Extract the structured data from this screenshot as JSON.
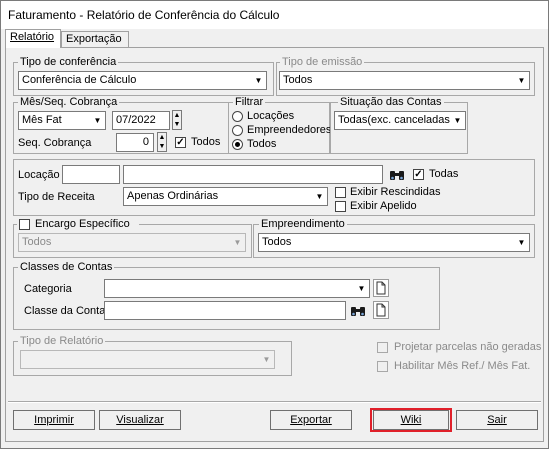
{
  "window": {
    "title": "Faturamento - Relatório de Conferência do Cálculo"
  },
  "tabs": {
    "relatorio": "Relatório",
    "exportacao": "Exportação"
  },
  "tipo_conferencia": {
    "label": "Tipo de conferência",
    "value": "Conferência de Cálculo"
  },
  "tipo_emissao": {
    "label": "Tipo de emissão",
    "value": "Todos"
  },
  "mes_seq": {
    "label": "Mês/Seq. Cobrança",
    "mes_select": "Mês Fat",
    "mes_value": "07/2022",
    "seq_label": "Seq. Cobrança",
    "seq_value": "0",
    "todos_label": "Todos",
    "todos_checked": true
  },
  "filtrar": {
    "label": "Filtrar",
    "options": [
      "Locações",
      "Empreendedores",
      "Todos"
    ],
    "selected": "Todos"
  },
  "situacao": {
    "label": "Situação das Contas",
    "value": "Todas(exc. canceladas)"
  },
  "locacao": {
    "label": "Locação",
    "code": "",
    "name": "",
    "todas_label": "Todas",
    "todas_checked": true,
    "tipo_receita_label": "Tipo de Receita",
    "tipo_receita_value": "Apenas Ordinárias",
    "exibir_rescindidas": "Exibir Rescindidas",
    "exibir_apelido": "Exibir Apelido"
  },
  "encargo": {
    "label": "Encargo Específico",
    "value": "Todos"
  },
  "empreendimento": {
    "label": "Empreendimento",
    "value": "Todos"
  },
  "classes": {
    "label": "Classes de Contas",
    "categoria_label": "Categoria",
    "categoria_value": "",
    "classe_label": "Classe da Conta",
    "classe_value": ""
  },
  "tipo_relatorio": {
    "label": "Tipo de Relatório",
    "value": ""
  },
  "options_right": {
    "projetar": "Projetar parcelas não geradas",
    "habilitar": "Habilitar Mês Ref./ Mês Fat."
  },
  "buttons": {
    "imprimir": "Imprimir",
    "visualizar": "Visualizar",
    "exportar": "Exportar",
    "wiki": "Wiki",
    "sair": "Sair"
  },
  "colors": {
    "highlight": "#e0202a",
    "frame": "#a8a8a8"
  }
}
